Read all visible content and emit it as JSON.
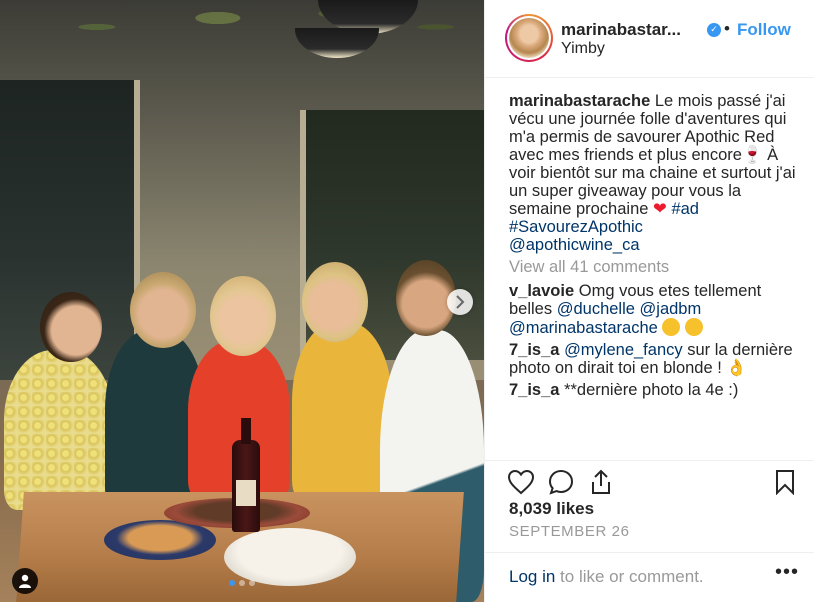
{
  "header": {
    "username": "marinabastar...",
    "follow_separator": "•",
    "follow_label": "Follow",
    "location": "Yimby",
    "verified_glyph": "✓"
  },
  "caption": {
    "username": "marinabastarache",
    "text": "Le mois passé j'ai vécu une journée folle d'aventures qui m'a permis de savourer Apothic Red avec mes friends et plus encore",
    "wine_emoji": "🍷",
    "text2": " À voir bientôt sur ma chaine et surtout j'ai un super giveaway pour vous la semaine prochaine ",
    "heart_emoji": "❤",
    "hashtag1": "#ad",
    "hashtag2": "#SavourezApothic",
    "mention": "@apothicwine_ca"
  },
  "view_all": "View all 41 comments",
  "comments": [
    {
      "username": "v_lavoie",
      "text": "Omg vous etes tellement belles",
      "mention1": "@duchelle",
      "mention2": "@jadbm",
      "mention3": "@marinabastarache"
    },
    {
      "username": "7_is_a",
      "mention": "@mylene_fancy",
      "text": "sur la dernière photo on dirait toi en blonde !",
      "emoji": "👌"
    },
    {
      "username": "7_is_a",
      "text": "**dernière photo la 4e :)"
    }
  ],
  "likes": "8,039 likes",
  "date": "SEPTEMBER 26",
  "footer": {
    "login_link": "Log in",
    "login_rest": " to like or comment.",
    "more": "•••"
  },
  "icons": {
    "like": "heart-icon",
    "comment": "comment-icon",
    "share": "share-icon",
    "save": "bookmark-icon",
    "next": "chevron-right-icon",
    "tag": "user-tag-icon"
  },
  "colors": {
    "link": "#003569",
    "follow": "#3897f0",
    "muted": "#999999",
    "text": "#262626"
  },
  "carousel": {
    "current": 1,
    "total": 3
  }
}
